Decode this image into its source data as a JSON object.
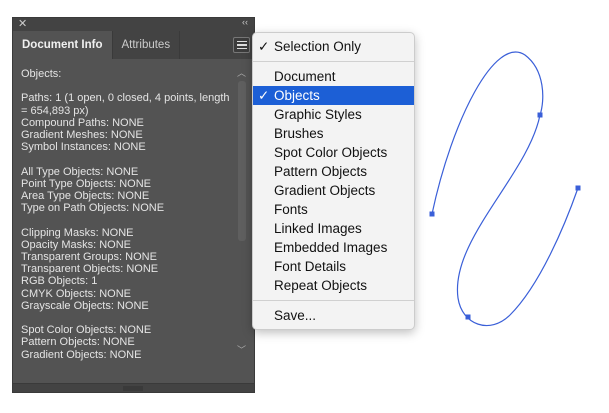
{
  "panel": {
    "close": "✕",
    "collapse": "‹‹",
    "tabs": [
      "Document Info",
      "Attributes"
    ],
    "lines": [
      "Objects:",
      "",
      "Paths: 1 (1 open, 0 closed, 4 points, length = 654,893 px)",
      "Compound Paths: NONE",
      "Gradient Meshes: NONE",
      "Symbol Instances: NONE",
      "",
      "All Type Objects: NONE",
      "Point Type Objects: NONE",
      "Area Type Objects: NONE",
      "Type on Path Objects: NONE",
      "",
      "Clipping Masks: NONE",
      "Opacity Masks: NONE",
      "Transparent Groups: NONE",
      "Transparent Objects: NONE",
      "RGB Objects: 1",
      "CMYK Objects: NONE",
      "Grayscale Objects: NONE",
      "",
      "Spot Color Objects: NONE",
      "Pattern Objects: NONE",
      "Gradient Objects: NONE"
    ]
  },
  "menu": {
    "check": "✓",
    "selection_only": "Selection Only",
    "items": [
      "Document",
      "Objects",
      "Graphic Styles",
      "Brushes",
      "Spot Color Objects",
      "Pattern Objects",
      "Gradient Objects",
      "Fonts",
      "Linked Images",
      "Embedded Images",
      "Font Details",
      "Repeat Objects"
    ],
    "selected": "Objects",
    "save": "Save..."
  },
  "colors": {
    "accent": "#1c5fd6",
    "path": "#3a5fd8"
  }
}
